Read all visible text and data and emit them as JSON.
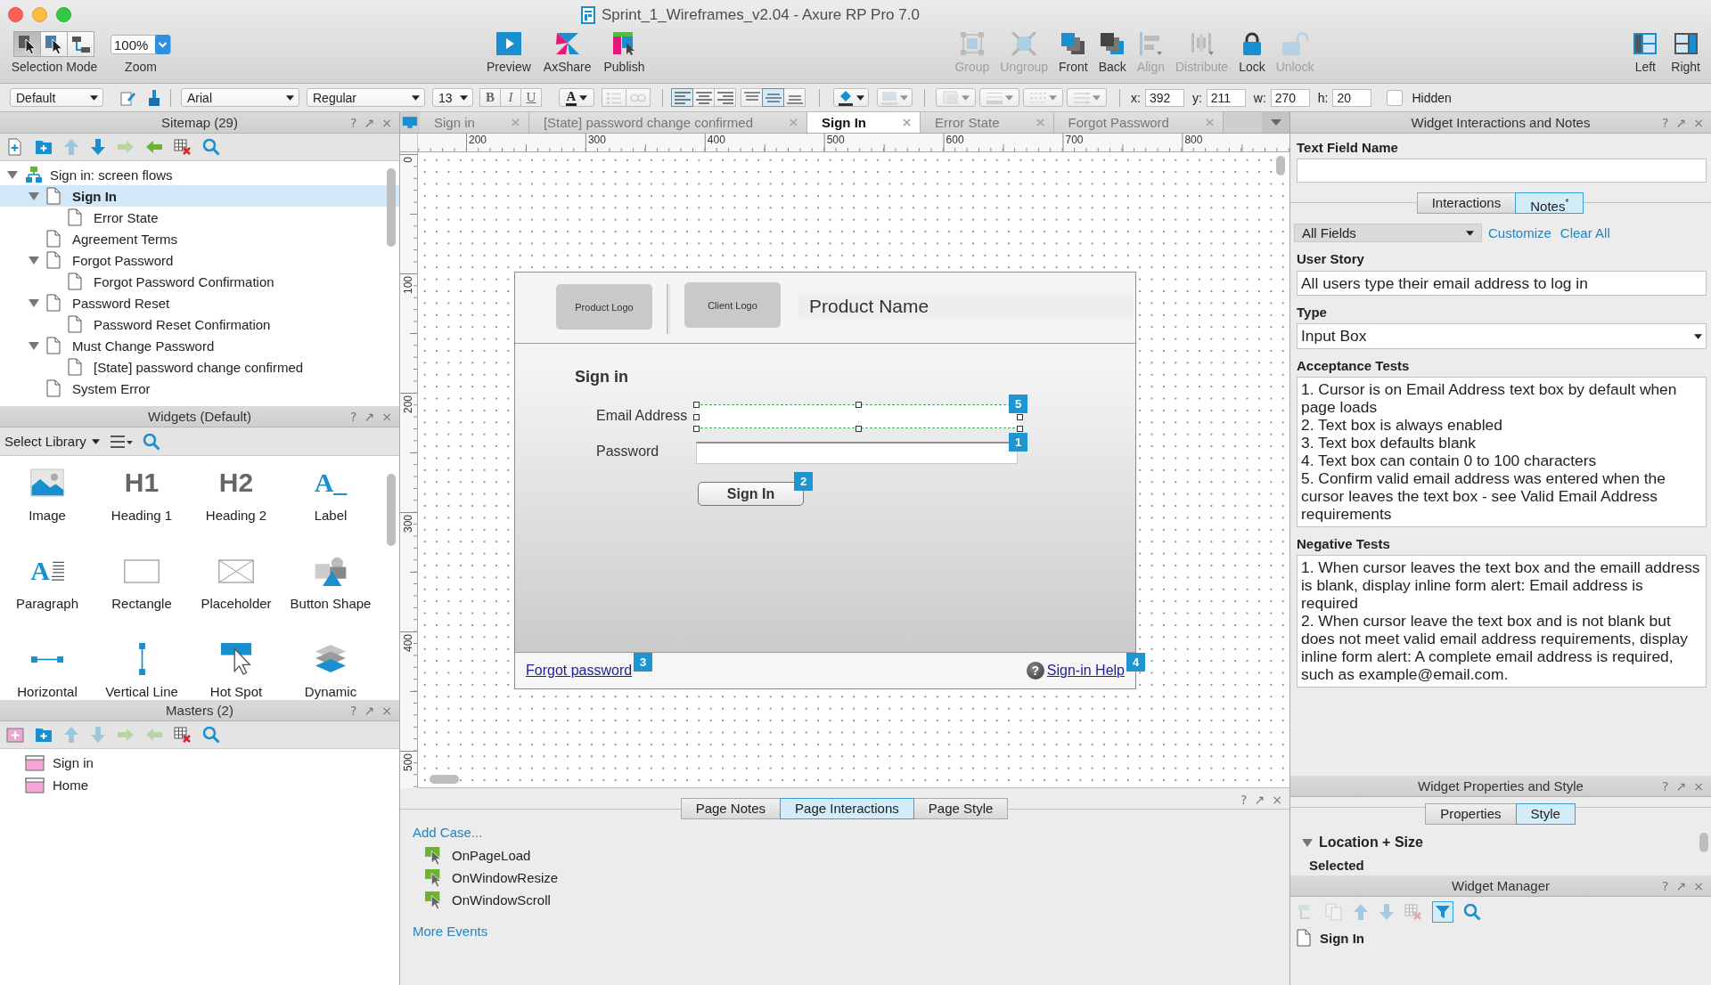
{
  "window": {
    "title": "Sprint_1_Wireframes_v2.04 - Axure RP Pro 7.0"
  },
  "toolbar": {
    "selection_mode": {
      "label": "Selection Mode",
      "modes": [
        {
          "selected": true
        },
        {
          "selected": false
        },
        {
          "selected": false
        }
      ]
    },
    "zoom": {
      "label": "Zoom",
      "value": "100%"
    },
    "publish_buttons": [
      {
        "label": "Preview"
      },
      {
        "label": "AxShare"
      },
      {
        "label": "Publish"
      }
    ],
    "arrange_buttons": [
      {
        "label": "Group",
        "disabled": true
      },
      {
        "label": "Ungroup",
        "disabled": true
      },
      {
        "label": "Front",
        "disabled": false
      },
      {
        "label": "Back",
        "disabled": false
      },
      {
        "label": "Align",
        "disabled": true
      },
      {
        "label": "Distribute",
        "disabled": true
      },
      {
        "label": "Lock",
        "disabled": false
      },
      {
        "label": "Unlock",
        "disabled": true
      }
    ],
    "layout_buttons": [
      {
        "label": "Left"
      },
      {
        "label": "Right"
      }
    ]
  },
  "format_bar": {
    "style": "Default",
    "font": "Arial",
    "weight": "Regular",
    "size": "13",
    "text_styles": [
      "B",
      "I",
      "U"
    ],
    "font_color": "A",
    "list_buttons": [
      {
        "disabled": true
      },
      {
        "disabled": true
      }
    ],
    "h_align": [
      {
        "selected": true
      },
      {
        "selected": false
      },
      {
        "selected": false
      }
    ],
    "v_align": [
      {
        "selected": false
      },
      {
        "selected": true
      },
      {
        "selected": false
      }
    ],
    "color_buttons": [
      {
        "disabled": false
      },
      {
        "disabled": true
      }
    ],
    "line_buttons": [
      {
        "disabled": true
      },
      {
        "disabled": true
      },
      {
        "disabled": true
      },
      {
        "disabled": true
      }
    ],
    "geometry": [
      {
        "label": "x:",
        "value": "392"
      },
      {
        "label": "y:",
        "value": "211"
      },
      {
        "label": "w:",
        "value": "270"
      },
      {
        "label": "h:",
        "value": "20"
      }
    ],
    "hidden": {
      "label": "Hidden",
      "checked": false
    }
  },
  "sitemap": {
    "title": "Sitemap (29)",
    "controls": [
      "?",
      "↗",
      "×"
    ],
    "tools": [
      {
        "disabled": false
      },
      {
        "disabled": false
      },
      {
        "disabled": true
      },
      {
        "disabled": false
      },
      {
        "disabled": true
      },
      {
        "disabled": false
      },
      {
        "disabled": false
      },
      {
        "disabled": false
      }
    ],
    "pages": [
      {
        "label": "Sign in: screen flows",
        "kind": "flow",
        "expanded": true,
        "selected": false,
        "children": [
          {
            "label": "Sign In",
            "kind": "page",
            "expanded": true,
            "selected": true,
            "children": [
              {
                "label": "Error State",
                "kind": "page",
                "selected": false
              }
            ]
          },
          {
            "label": "Agreement Terms",
            "kind": "page",
            "selected": false
          },
          {
            "label": "Forgot Password",
            "kind": "page",
            "expanded": true,
            "selected": false,
            "children": [
              {
                "label": "Forgot Password Confirmation",
                "kind": "page",
                "selected": false
              }
            ]
          },
          {
            "label": "Password Reset",
            "kind": "page",
            "expanded": true,
            "selected": false,
            "children": [
              {
                "label": "Password Reset Confirmation",
                "kind": "page",
                "selected": false
              }
            ]
          },
          {
            "label": "Must Change Password",
            "kind": "page",
            "expanded": true,
            "selected": false,
            "children": [
              {
                "label": "[State] password change confirmed",
                "kind": "page",
                "selected": false
              }
            ]
          },
          {
            "label": "System Error",
            "kind": "page",
            "selected": false
          }
        ]
      }
    ]
  },
  "widgets": {
    "title": "Widgets (Default)",
    "controls": [
      "?",
      "↗",
      "×"
    ],
    "library": "Select Library",
    "items": [
      {
        "label": "Image"
      },
      {
        "label": "Heading 1",
        "glyph": "H1"
      },
      {
        "label": "Heading 2",
        "glyph": "H2"
      },
      {
        "label": "Label",
        "glyph": "A_"
      },
      {
        "label": "Paragraph",
        "glyph": "A"
      },
      {
        "label": "Rectangle"
      },
      {
        "label": "Placeholder"
      },
      {
        "label": "Button Shape"
      },
      {
        "label": "Horizontal"
      },
      {
        "label": "Vertical Line"
      },
      {
        "label": "Hot Spot"
      },
      {
        "label": "Dynamic"
      }
    ]
  },
  "masters": {
    "title": "Masters (2)",
    "controls": [
      "?",
      "↗",
      "×"
    ],
    "tools": [
      {
        "disabled": false
      },
      {
        "disabled": false
      },
      {
        "disabled": true
      },
      {
        "disabled": true
      },
      {
        "disabled": true
      },
      {
        "disabled": true
      },
      {
        "disabled": false
      },
      {
        "disabled": false
      }
    ],
    "items": [
      {
        "label": "Sign in"
      },
      {
        "label": "Home"
      }
    ]
  },
  "page_tabs": [
    {
      "label": "Sign in",
      "selected": false
    },
    {
      "label": "[State] password change confirmed",
      "selected": false
    },
    {
      "label": "Sign In",
      "selected": true
    },
    {
      "label": "Error State",
      "selected": false
    },
    {
      "label": "Forgot Password",
      "selected": false
    }
  ],
  "ruler": {
    "x_labels": [
      "200",
      "300",
      "400",
      "500",
      "600",
      "700",
      "800"
    ],
    "y_labels": [
      "0",
      "100",
      "200",
      "300",
      "400",
      "500"
    ]
  },
  "wireframe": {
    "header": {
      "logos": [
        "Product Logo",
        "Client Logo"
      ],
      "product_name": "Product Name"
    },
    "heading": "Sign in",
    "fields": [
      {
        "label": "Email Address",
        "selected": true,
        "note": "5"
      },
      {
        "label": "Password",
        "selected": false,
        "note": "1"
      }
    ],
    "button": {
      "label": "Sign In",
      "note": "2"
    },
    "links": [
      {
        "label": "Forgot password",
        "note": "3"
      },
      {
        "label": "Sign-in Help",
        "glyph": "?",
        "note": "4"
      }
    ]
  },
  "page_panel": {
    "controls": [
      "?",
      "↗",
      "×"
    ],
    "tabs": [
      {
        "label": "Page Notes",
        "selected": false
      },
      {
        "label": "Page Interactions",
        "selected": true
      },
      {
        "label": "Page Style",
        "selected": false
      }
    ],
    "add_case": "Add Case...",
    "events": [
      "OnPageLoad",
      "OnWindowResize",
      "OnWindowScroll"
    ],
    "more_events": "More Events"
  },
  "notes_panel": {
    "title": "Widget Interactions and Notes",
    "controls": [
      "?",
      "↗",
      "×"
    ],
    "name_field": {
      "label": "Text Field Name"
    },
    "tabs": [
      {
        "label": "Interactions",
        "selected": false
      },
      {
        "label": "Notes$^{*}$",
        "selected": true
      }
    ],
    "field_set": "All Fields",
    "links": [
      "Customize",
      "Clear All"
    ],
    "fields": [
      {
        "kind": "text",
        "label": "User Story",
        "value": "All users type their email address to log in"
      },
      {
        "kind": "select",
        "label": "Type",
        "value": "Input Box"
      },
      {
        "kind": "area",
        "label": "Acceptance Tests",
        "value": "1. Cursor is on Email Address text box by default when page loads\n2. Text box is always enabled\n3. Text box defaults blank\n4. Text box can contain 0 to 100 characters\n5. Confirm valid email address was entered when the cursor leaves the text box - see Valid Email Address requirements"
      },
      {
        "kind": "area",
        "label": "Negative Tests",
        "value": "1. When cursor leaves the text box and the emaill address is blank, display inline form alert: Email address is required\n2. When cursor leave the text box and is not blank but does not meet valid email address requirements, display inline form alert: A complete email address is required, such as example@email.com."
      }
    ]
  },
  "style_panel": {
    "title": "Widget Properties and Style",
    "controls": [
      "?",
      "↗",
      "×"
    ],
    "tabs": [
      {
        "label": "Properties",
        "selected": false
      },
      {
        "label": "Style",
        "selected": true
      }
    ],
    "section": {
      "label": "Location + Size",
      "expanded": true
    },
    "subheading": "Selected"
  },
  "widget_manager": {
    "title": "Widget Manager",
    "controls": [
      "?",
      "↗",
      "×"
    ],
    "tools": [
      {
        "disabled": true,
        "selected": false
      },
      {
        "disabled": true,
        "selected": false
      },
      {
        "disabled": true,
        "selected": false
      },
      {
        "disabled": true,
        "selected": false
      },
      {
        "disabled": true,
        "selected": false
      },
      {
        "disabled": false,
        "selected": true
      },
      {
        "disabled": false,
        "selected": false
      }
    ],
    "items": [
      {
        "label": "Sign In"
      }
    ]
  }
}
